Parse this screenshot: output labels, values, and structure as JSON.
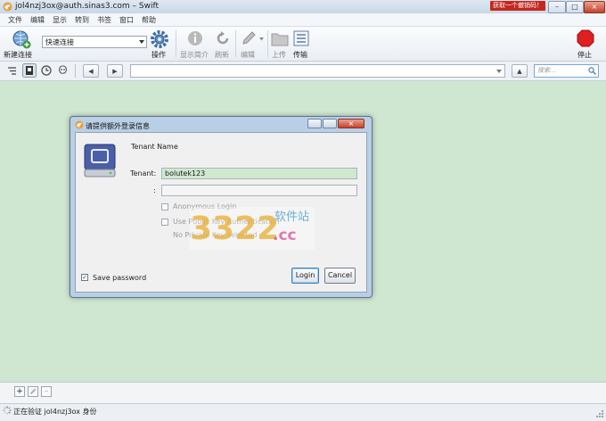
{
  "window": {
    "title": "jol4nzj3ox@auth.sinas3.com – Swift",
    "promo_text": "获取一个撤销码！",
    "minimize_glyph": "–",
    "maximize_glyph": "□",
    "close_glyph": "×"
  },
  "menu": [
    "文件",
    "编辑",
    "显示",
    "转到",
    "书签",
    "窗口",
    "帮助"
  ],
  "toolbar": {
    "new_connection": "新建连接",
    "quick_connect": "快速连接",
    "action": "操作",
    "info": "显示简介",
    "refresh": "刷新",
    "edit": "编辑",
    "upload": "上传",
    "transfers": "传输",
    "stop": "停止"
  },
  "navbar": {
    "search_placeholder": "搜索...",
    "back_glyph": "◀",
    "forward_glyph": "▶",
    "up_glyph": "▲"
  },
  "dialog": {
    "title": "请提供额外登录信息",
    "heading": "Tenant Name",
    "tenant_label": "Tenant:",
    "tenant_value": "bolutek123",
    "password_label": ":",
    "anonymous_login": "Anonymous Login",
    "public_key_auth": "Use Public Key Authentication",
    "no_private_key": "No Private Key selected",
    "save_password": "Save password",
    "login_button": "Login",
    "cancel_button": "Cancel"
  },
  "watermark": {
    "number": "3322",
    "domain": ".cc",
    "text": "软件站"
  },
  "bottom": {
    "add": "+",
    "remove": "–"
  },
  "status": {
    "text": "正在验证 jol4nzj3ox 身份"
  },
  "colors": {
    "content_bg": "#cfe6d1",
    "stop_red": "#e02020",
    "tenant_field": "#cfe9cf"
  }
}
